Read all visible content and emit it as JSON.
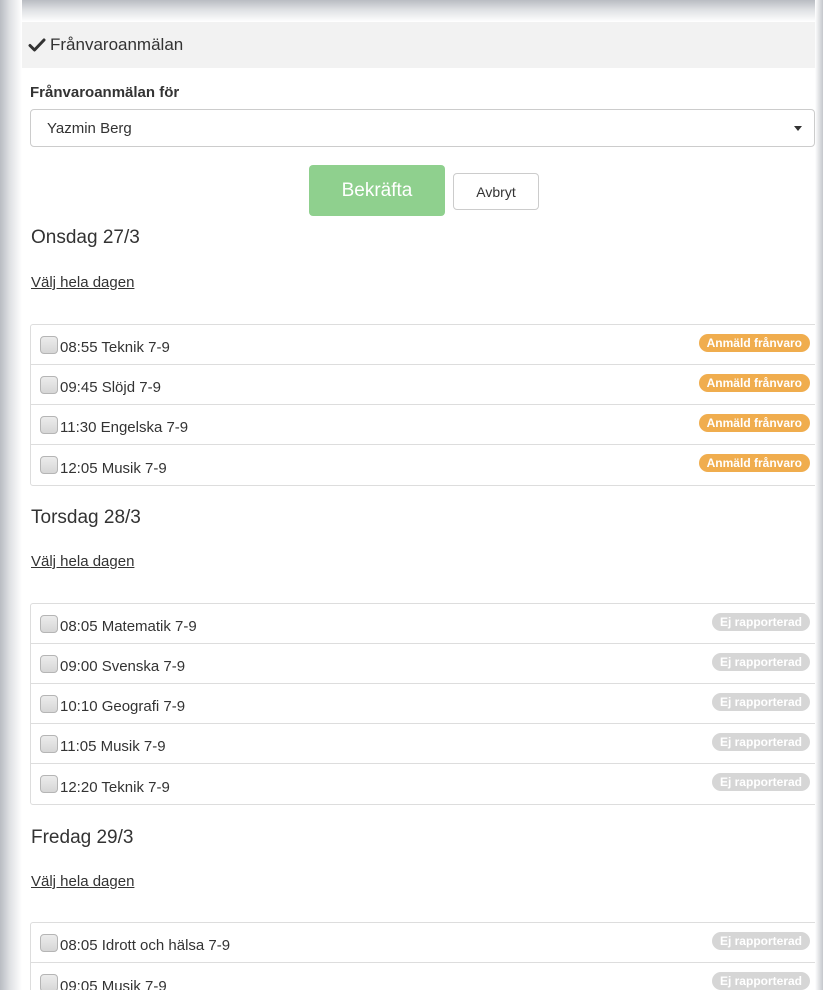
{
  "panel": {
    "title": "Frånvaroanmälan",
    "header_icon": "checkmark-icon"
  },
  "form": {
    "label": "Frånvaroanmälan för",
    "student": "Yazmin Berg",
    "confirm_label": "Bekräfta",
    "cancel_label": "Avbryt"
  },
  "colors": {
    "confirm": "#8fd08e",
    "reported": "#f0ad4e",
    "not_reported": "#d6d6d6"
  },
  "days": [
    {
      "title": "Onsdag 27/3",
      "select_all": "Välj hela dagen",
      "lessons": [
        {
          "label": "08:55 Teknik 7-9",
          "status": "Anmäld frånvaro"
        },
        {
          "label": "09:45 Slöjd 7-9",
          "status": "Anmäld frånvaro"
        },
        {
          "label": "11:30 Engelska 7-9",
          "status": "Anmäld frånvaro"
        },
        {
          "label": "12:05 Musik 7-9",
          "status": "Anmäld frånvaro"
        }
      ]
    },
    {
      "title": "Torsdag 28/3",
      "select_all": "Välj hela dagen",
      "lessons": [
        {
          "label": "08:05 Matematik 7-9",
          "status": "Ej rapporterad"
        },
        {
          "label": "09:00 Svenska 7-9",
          "status": "Ej rapporterad"
        },
        {
          "label": "10:10 Geografi 7-9",
          "status": "Ej rapporterad"
        },
        {
          "label": "11:05 Musik 7-9",
          "status": "Ej rapporterad"
        },
        {
          "label": "12:20 Teknik 7-9",
          "status": "Ej rapporterad"
        }
      ]
    },
    {
      "title": "Fredag 29/3",
      "select_all": "Välj hela dagen",
      "lessons": [
        {
          "label": "08:05 Idrott och hälsa 7-9",
          "status": "Ej rapporterad"
        },
        {
          "label": "09:05 Musik 7-9",
          "status": "Ej rapporterad"
        }
      ]
    }
  ]
}
